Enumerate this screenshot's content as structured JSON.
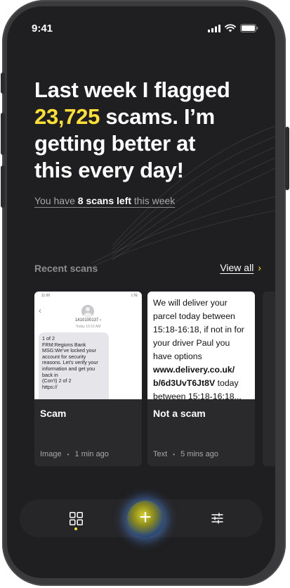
{
  "status": {
    "time": "9:41"
  },
  "headline": {
    "line1": "Last week I flagged",
    "count": "23,725",
    "line2_rest": " scams. I’m",
    "line3": "getting better at",
    "line4": "this every day!"
  },
  "scans_left": {
    "prefix": "You have ",
    "value": "8 scans left",
    "suffix": " this week"
  },
  "recent": {
    "title": "Recent scans",
    "view_all": "View all",
    "view_all_chevron": "›"
  },
  "cards": [
    {
      "label": "Scam",
      "type": "Image",
      "time": "1 min ago",
      "sms": {
        "clock": "11:00",
        "network": "LTE",
        "number": "1410100137 ›",
        "when": "Today 10:16 AM",
        "message": "1 of 2\nFRM:Regions Bank\nMSG:We’ve locked your account for security reasons. Let’s verify your information and get you back in\n(Con’t) 2 of 2\nhttps://"
      }
    },
    {
      "label": "Not a scam",
      "type": "Text",
      "time": "5 mins ago",
      "text_before": "We will deliver your parcel today between 15:18-16:18, if not in for your driver Paul you have options ",
      "text_link": "www.delivery.co.uk/ b/6d3UvT6Jt8V",
      "text_after": " today between 15:18-16:18..."
    }
  ],
  "meta_separator": "•",
  "tabbar": {
    "fab_symbol": "+"
  },
  "colors": {
    "accent": "#ffe135",
    "background": "#1f1f21",
    "card": "#2a2a2c"
  },
  "icons": [
    "signal-icon",
    "wifi-icon",
    "battery-icon",
    "grid-icon",
    "plus-icon",
    "sliders-icon",
    "chevron-right-icon",
    "back-chevron-icon",
    "contact-avatar-icon"
  ]
}
